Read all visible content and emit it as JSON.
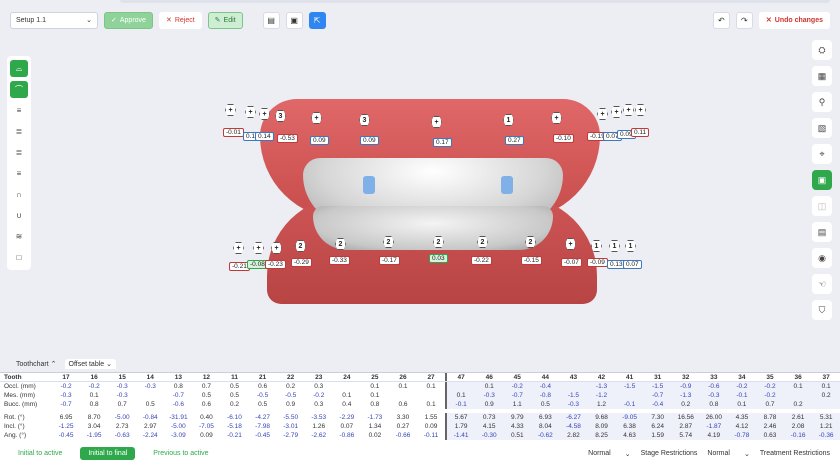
{
  "toolbar": {
    "setup": "Setup 1.1",
    "approve": "Approve",
    "reject": "Reject",
    "edit": "Edit",
    "undo_changes": "Undo changes"
  },
  "tabs": {
    "toothchart": "Toothchart",
    "offset": "Offset table"
  },
  "table": {
    "teeth": [
      "17",
      "16",
      "15",
      "14",
      "13",
      "12",
      "11",
      "21",
      "22",
      "23",
      "24",
      "25",
      "26",
      "27",
      "47",
      "46",
      "45",
      "44",
      "43",
      "42",
      "41",
      "31",
      "32",
      "33",
      "34",
      "35",
      "36",
      "37"
    ],
    "rows": [
      {
        "label": "Occl. (mm)",
        "values": [
          "-0.2",
          "-0.2",
          "-0.3",
          "-0.3",
          "0.8",
          "0.7",
          "0.5",
          "0.6",
          "0.2",
          "0.3",
          "",
          "0.1",
          "0.1",
          "0.1",
          "",
          "0.1",
          "-0.2",
          "-0.4",
          "",
          "-1.3",
          "-1.5",
          "-1.5",
          "-0.9",
          "-0.6",
          "-0.2",
          "-0.2",
          "0.1",
          "0.1"
        ]
      },
      {
        "label": "Mes. (mm)",
        "values": [
          "-0.3",
          "0.1",
          "-0.3",
          "",
          "-0.7",
          "0.5",
          "0.5",
          "-0.5",
          "-0.5",
          "-0.2",
          "0.1",
          "0.1",
          "",
          "",
          "0.1",
          "-0.3",
          "-0.7",
          "-0.8",
          "-1.5",
          "-1.2",
          "",
          "-0.7",
          "-1.3",
          "-0.3",
          "-0.1",
          "-0.2",
          "",
          "0.2"
        ]
      },
      {
        "label": "Bucc. (mm)",
        "values": [
          "-0.7",
          "0.8",
          "0.7",
          "0.5",
          "-0.6",
          "0.6",
          "0.2",
          "0.5",
          "0.9",
          "0.3",
          "0.4",
          "0.8",
          "0.6",
          "0.1",
          "-0.1",
          "0.9",
          "1.1",
          "0.5",
          "-0.3",
          "1.2",
          "-0.1",
          "-0.4",
          "0.2",
          "0.8",
          "0.1",
          "0.7",
          "0.2",
          ""
        ]
      },
      {
        "label": "Rot. (°)",
        "values": [
          "6.95",
          "8.70",
          "-5.00",
          "-0.84",
          "-31.91",
          "0.40",
          "-6.10",
          "-4.27",
          "-5.50",
          "-3.53",
          "-2.29",
          "-1.73",
          "3.30",
          "1.55",
          "5.67",
          "0.73",
          "9.79",
          "6.93",
          "-6.27",
          "9.68",
          "-9.05",
          "7.30",
          "16.56",
          "26.00",
          "4.35",
          "8.78",
          "2.61",
          "5.31"
        ]
      },
      {
        "label": "Incl. (°)",
        "values": [
          "-1.25",
          "3.04",
          "2.73",
          "2.97",
          "-5.00",
          "-7.05",
          "-5.18",
          "-7.98",
          "-3.01",
          "1.26",
          "0.07",
          "1.34",
          "0.27",
          "0.09",
          "1.79",
          "4.15",
          "4.33",
          "8.04",
          "-4.58",
          "8.09",
          "6.38",
          "6.24",
          "2.87",
          "-1.87",
          "4.12",
          "2.46",
          "2.08",
          "1.21"
        ]
      },
      {
        "label": "Ang. (°)",
        "values": [
          "-0.45",
          "-1.95",
          "-0.63",
          "-2.24",
          "-3.09",
          "0.09",
          "-0.21",
          "-0.45",
          "-2.79",
          "-2.62",
          "-0.86",
          "0.02",
          "-0.66",
          "-0.11",
          "-1.41",
          "-0.30",
          "0.51",
          "-0.62",
          "2.82",
          "8.25",
          "4.63",
          "1.59",
          "5.74",
          "4.19",
          "-0.78",
          "0.63",
          "-0.16",
          "-0.36"
        ]
      }
    ]
  },
  "upper_labels": [
    {
      "t": "-0.01",
      "c": ""
    },
    {
      "t": "0.11",
      "c": "blue"
    },
    {
      "t": "0.14",
      "c": "blue"
    },
    {
      "t": "-0.53",
      "c": ""
    },
    {
      "t": "0.09",
      "c": "blue"
    },
    {
      "t": "0.09",
      "c": "blue"
    },
    {
      "t": "0.17",
      "c": "blue"
    },
    {
      "t": "0.27",
      "c": "blue"
    },
    {
      "t": "-0.10",
      "c": ""
    },
    {
      "t": "-0.19",
      "c": ""
    },
    {
      "t": "0.07",
      "c": "blue"
    },
    {
      "t": "0.09",
      "c": "blue"
    },
    {
      "t": "0.11",
      "c": ""
    }
  ],
  "lower_labels": [
    {
      "t": "-0.21",
      "c": ""
    },
    {
      "t": "-0.08",
      "c": "green"
    },
    {
      "t": "-0.23",
      "c": ""
    },
    {
      "t": "-0.29",
      "c": ""
    },
    {
      "t": "-0.33",
      "c": ""
    },
    {
      "t": "-0.17",
      "c": ""
    },
    {
      "t": "0.03",
      "c": "green"
    },
    {
      "t": "-0.22",
      "c": ""
    },
    {
      "t": "-0.15",
      "c": ""
    },
    {
      "t": "-0.07",
      "c": ""
    },
    {
      "t": "-0.09",
      "c": ""
    },
    {
      "t": "0.13",
      "c": "blue"
    },
    {
      "t": "0.07",
      "c": "blue"
    }
  ],
  "bottom": {
    "initial_active": "Initial to active",
    "initial_final": "Initial to final",
    "previous_active": "Previous to active",
    "normal1": "Normal",
    "stage_restrictions": "Stage Restrictions",
    "normal2": "Normal",
    "treatment_restrictions": "Treatment Restrictions"
  }
}
